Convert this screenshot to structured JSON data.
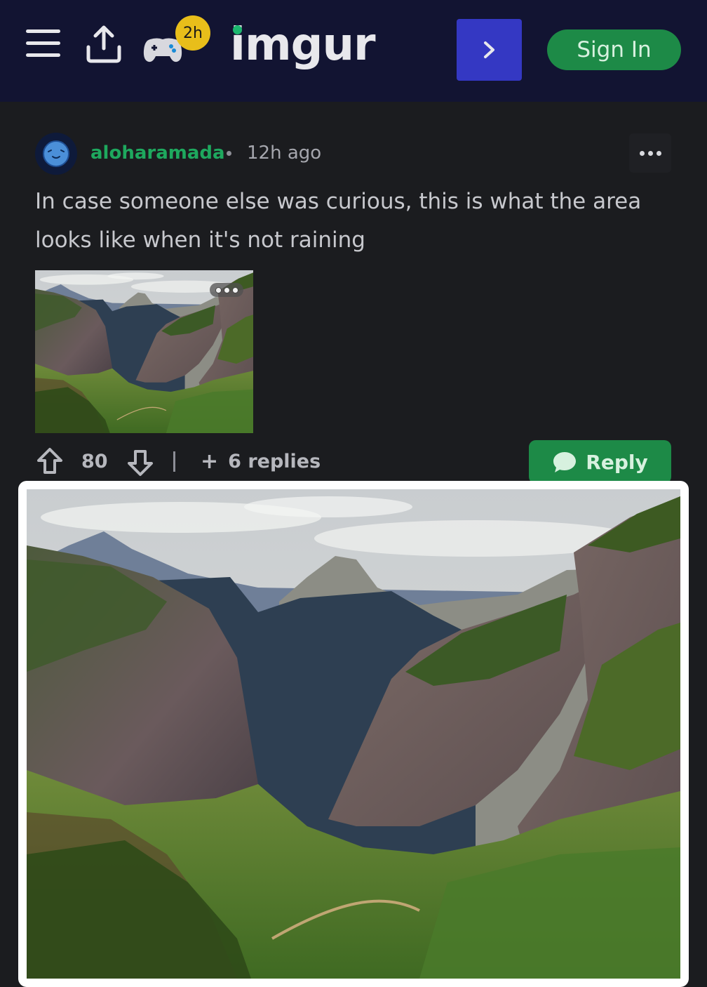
{
  "header": {
    "menu_icon": "hamburger-menu-icon",
    "upload_icon": "upload-icon",
    "game_icon": "gamepad-icon",
    "game_badge": "2h",
    "logo": "imgur",
    "next_icon": "chevron-right-icon",
    "sign_in_label": "Sign In",
    "colors": {
      "bar": "#121432",
      "accent_blue": "#3438c3",
      "accent_green": "#1d8a47",
      "logo_dot": "#1bb76e"
    }
  },
  "comment": {
    "avatar_icon": "blue-planet-avatar",
    "username": "aloharamada",
    "timestamp": "12h ago",
    "text": "In case someone else was curious, this is what the area looks like when it's not raining",
    "attachment_alt": "Green valley between steep granite mountains",
    "more_icon": "more-options-icon"
  },
  "actions": {
    "upvote_icon": "upvote-arrow-icon",
    "vote_count": "80",
    "downvote_icon": "downvote-arrow-icon",
    "replies_label": "6 replies",
    "reply_label": "Reply",
    "reply_icon": "speech-bubble-icon"
  }
}
